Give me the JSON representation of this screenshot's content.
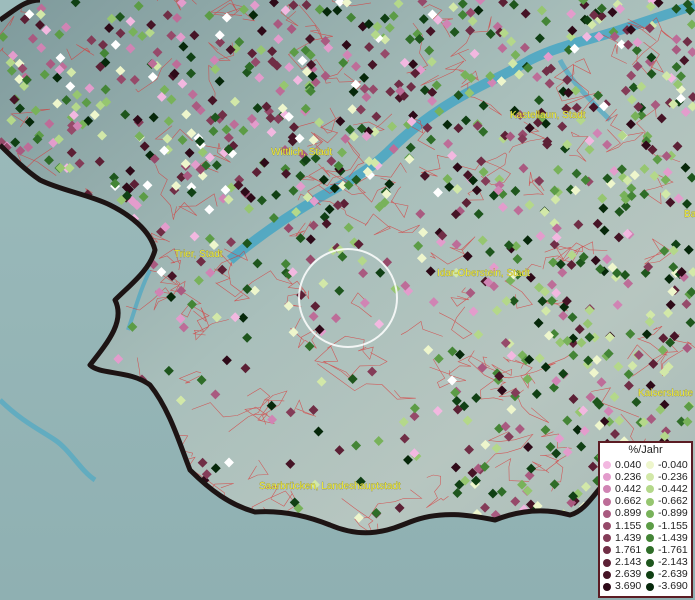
{
  "map": {
    "cities": [
      {
        "name": "Kastellaun, Stadt"
      },
      {
        "name": "Wittlich, Stadt"
      },
      {
        "name": "Trier, Stadt"
      },
      {
        "name": "Idar-Oberstein, Stadt"
      },
      {
        "name": "Kaiserslaute"
      },
      {
        "name": "Saarbrücken, Landeshauptstadt"
      },
      {
        "name": "Ba"
      }
    ]
  },
  "legend": {
    "title": "%/Jahr",
    "positive": [
      {
        "label": "0.040",
        "color": "#f2b8e0"
      },
      {
        "label": "0.236",
        "color": "#e39ccc"
      },
      {
        "label": "0.442",
        "color": "#d084b4"
      },
      {
        "label": "0.662",
        "color": "#bd6d98"
      },
      {
        "label": "0.899",
        "color": "#a95a80"
      },
      {
        "label": "1.155",
        "color": "#964a6a"
      },
      {
        "label": "1.439",
        "color": "#843c58"
      },
      {
        "label": "1.761",
        "color": "#702e46"
      },
      {
        "label": "2.143",
        "color": "#5c2035"
      },
      {
        "label": "2.639",
        "color": "#461426"
      },
      {
        "label": "3.690",
        "color": "#2e0a18"
      }
    ],
    "negative": [
      {
        "label": "-0.040",
        "color": "#eef6cc"
      },
      {
        "label": "-0.236",
        "color": "#d2e8a8"
      },
      {
        "label": "-0.442",
        "color": "#b4d88a"
      },
      {
        "label": "-0.662",
        "color": "#96c670"
      },
      {
        "label": "-0.899",
        "color": "#78b25a"
      },
      {
        "label": "-1.155",
        "color": "#5c9c46"
      },
      {
        "label": "-1.439",
        "color": "#448536"
      },
      {
        "label": "-1.761",
        "color": "#2f6d28"
      },
      {
        "label": "-2.143",
        "color": "#1e561d"
      },
      {
        "label": "-2.639",
        "color": "#104014"
      },
      {
        "label": "-3.690",
        "color": "#06280a"
      }
    ]
  }
}
